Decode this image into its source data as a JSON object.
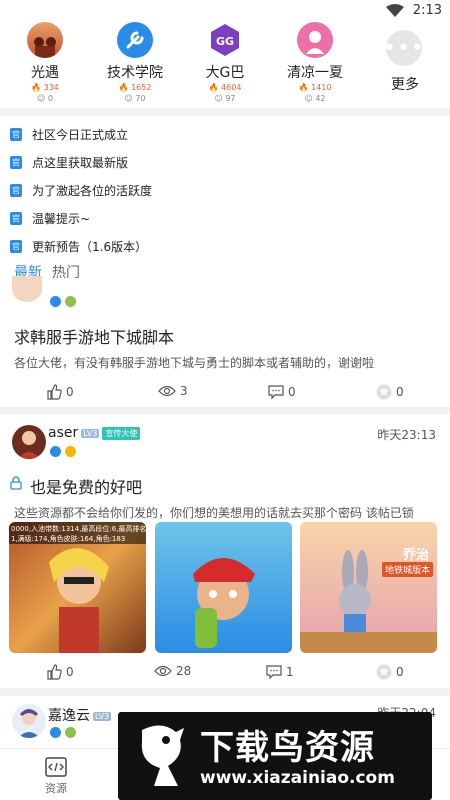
{
  "status": {
    "time": "2:13"
  },
  "communities": [
    {
      "name": "光遇",
      "heat": "334",
      "members": "0"
    },
    {
      "name": "技术学院",
      "heat": "1652",
      "members": "70"
    },
    {
      "name": "大G巴",
      "heat": "4604",
      "members": "97"
    },
    {
      "name": "清凉一夏",
      "heat": "1410",
      "members": "42"
    }
  ],
  "more_label": "更多",
  "announcements": {
    "tag": "官",
    "items": [
      "社区今日正式成立",
      "点这里获取最新版",
      "为了激起各位的活跃度",
      "温馨提示~",
      "更新预告（1.6版本）"
    ]
  },
  "tabs": {
    "latest": "最新",
    "hot": "热门"
  },
  "post1": {
    "title": "求韩服手游地下城脚本",
    "body": "各位大佬，有没有韩服手游地下城与勇士的脚本或者辅助的，谢谢啦",
    "likes": "0",
    "views": "3",
    "comments": "0",
    "favs": "0"
  },
  "post2": {
    "author": "aser",
    "level": "LV3",
    "role": "宣传大使",
    "time": "昨天23:13",
    "title": "也是免费的好吧",
    "body": "这些资源都不会给你们发的，你们想的美想用的话就去买那个密码 该帖已锁",
    "thumb1_text": "0000,入池带数:1314,最高段位:6,最高排名",
    "thumb1_text2": "1,满级:174,角色皮肤:164,角色:183",
    "thumb3_text": "乔治",
    "thumb3_text2": "地铁城版本",
    "likes": "0",
    "views": "28",
    "comments": "1",
    "favs": "0"
  },
  "post3": {
    "author": "嘉逸云",
    "level": "LV3",
    "time": "昨天22:04"
  },
  "bottom_nav": {
    "resources": "资源"
  },
  "watermark": {
    "brand": "下载鸟资源",
    "url": "www.xiazainiao.com"
  }
}
